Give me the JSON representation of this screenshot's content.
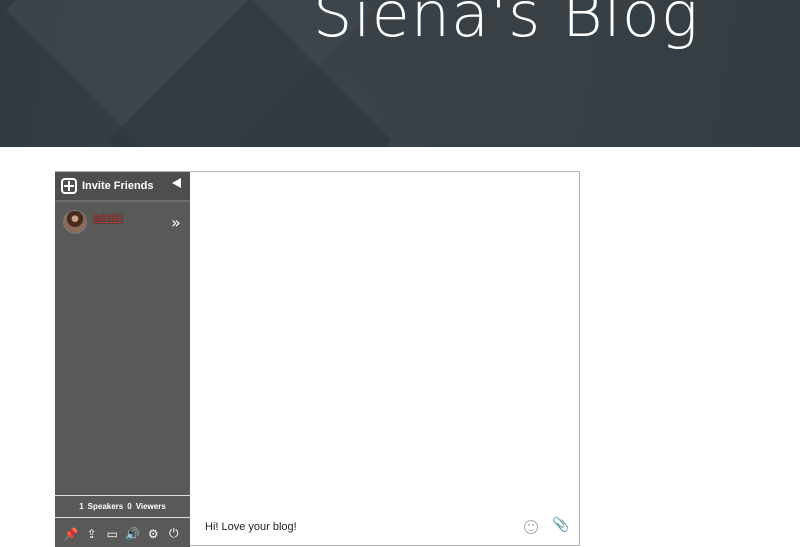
{
  "header": {
    "title": "Siena's Blog"
  },
  "chat": {
    "invite_label": "Invite Friends",
    "users": [
      {
        "name": "admin"
      }
    ],
    "counts": {
      "speakers_count": "1",
      "speakers_label": "Speakers",
      "viewers_count": "0",
      "viewers_label": "Viewers"
    },
    "toolbar": [
      {
        "name": "pin-icon",
        "glyph": "📌"
      },
      {
        "name": "upload-icon",
        "glyph": "⇪"
      },
      {
        "name": "window-icon",
        "glyph": "▭"
      },
      {
        "name": "volume-icon",
        "glyph": "🔊"
      },
      {
        "name": "settings-icon",
        "glyph": "⚙"
      },
      {
        "name": "power-icon",
        "glyph": "⏻"
      }
    ],
    "message_value": "Hi! Love your blog!"
  }
}
